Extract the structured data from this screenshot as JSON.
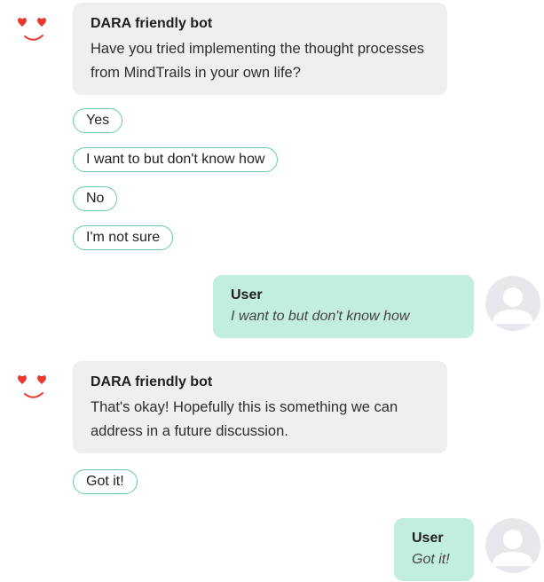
{
  "messages": [
    {
      "sender": "DARA friendly bot",
      "text": "Have you tried implementing the thought processes from MindTrails in your own life?",
      "options": [
        "Yes",
        "I want to but don't know how",
        "No",
        "I'm not sure"
      ]
    },
    {
      "sender": "User",
      "text": "I want to but don't know how"
    },
    {
      "sender": "DARA friendly bot",
      "text": "That's okay! Hopefully this is something we can address in a future discussion.",
      "options": [
        "Got it!"
      ]
    },
    {
      "sender": "User",
      "text": "Got it!"
    }
  ],
  "colors": {
    "bot_bubble": "#efefef",
    "user_bubble": "#c2eedd",
    "chip_border": "#67c9b1",
    "bot_face": "#e8382f"
  },
  "icons": {
    "bot_avatar": "heart-eyes-smile-icon",
    "user_avatar": "user-silhouette-icon"
  }
}
